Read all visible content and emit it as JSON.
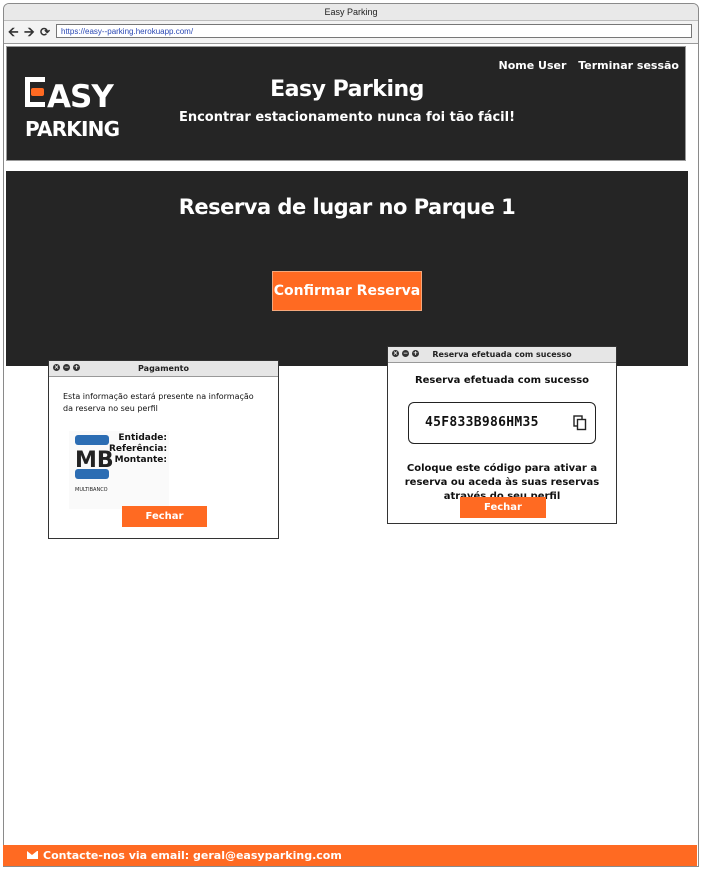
{
  "browser": {
    "title": "Easy Parking",
    "url": "https://easy--parking.herokuapp.com/",
    "nav_icons": [
      "back-arrow-icon",
      "forward-arrow-icon",
      "reload-icon"
    ]
  },
  "header": {
    "logo_line1": "EASY",
    "logo_line2": "PARKING",
    "title": "Easy Parking",
    "tagline": "Encontrar estacionamento nunca foi tão fácil!",
    "user_name": "Nome User",
    "logout": "Terminar sessão"
  },
  "main": {
    "title": "Reserva de lugar no Parque 1",
    "confirm_label": "Confirmar Reserva"
  },
  "payment_window": {
    "title": "Pagamento",
    "info": "Esta informação estará presente na informação da reserva no seu perfil",
    "mb_logo": "MB",
    "mb_caption": "MULTIBANCO",
    "labels": [
      "Entidade:",
      "Referência:",
      "Montante:"
    ],
    "close_label": "Fechar"
  },
  "success_window": {
    "title": "Reserva efetuada com sucesso",
    "heading": "Reserva efetuada com sucesso",
    "code": "45F833B986HM35",
    "instructions": "Coloque este código para ativar a reserva ou aceda às suas reservas através do seu perfil",
    "close_label": "Fechar"
  },
  "footer": {
    "contact": "Contacte-nos via email: geral@easyparking.com"
  },
  "colors": {
    "accent": "#ff6a22",
    "dark": "#252525"
  }
}
